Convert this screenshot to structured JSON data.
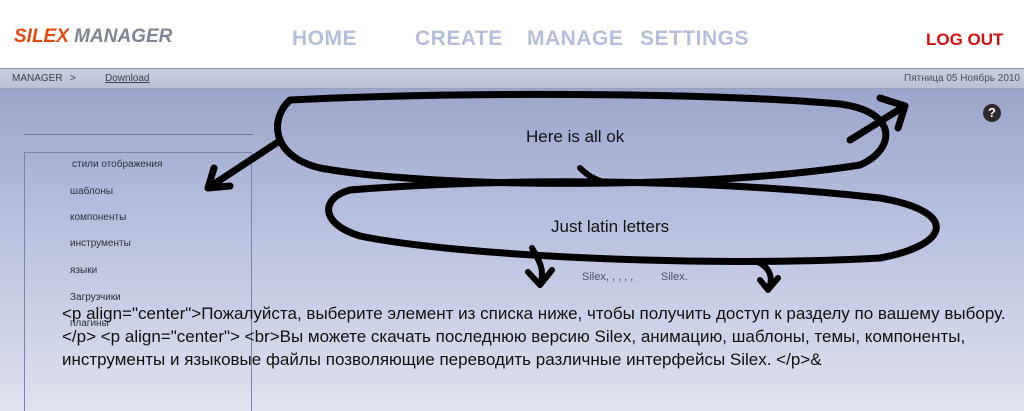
{
  "app": {
    "logo_part1": "SILEX",
    "logo_part2": " MANAGER",
    "nav": [
      "HOME",
      "CREATE",
      "MANAGE",
      "SETTINGS"
    ],
    "logout": "LOG OUT"
  },
  "breadcrumb": {
    "root": "MANAGER",
    "separator": ">",
    "link": "Download",
    "date": "Пятница 05 Ноябрь 2010"
  },
  "sidebar": {
    "items": [
      "стили отображения",
      "шаблоны",
      "компоненты",
      "инструменты",
      "языки",
      "Загрузчики",
      "плагины"
    ]
  },
  "help": "?",
  "main": {
    "garbled_line": "Silex, , , , ,         Silex."
  },
  "annotations": {
    "label1": "Here is all ok",
    "label2": "Just latin letters",
    "overlay_text": "<p align=\"center\">Пожалуйста, выберите элемент из списка ниже, чтобы получить доступ к разделу по вашему выбору. </p> <p align=\"center\"> <br>Вы можете скачать последнюю версию Silex, анимацию, шаблоны, темы, компоненты, инструменты и языковые файлы позволяющие переводить различные интерфейсы Silex. </p>&"
  },
  "colors": {
    "accent": "#e24a12",
    "nav": "#b5bedb",
    "logout": "#d40f10"
  }
}
